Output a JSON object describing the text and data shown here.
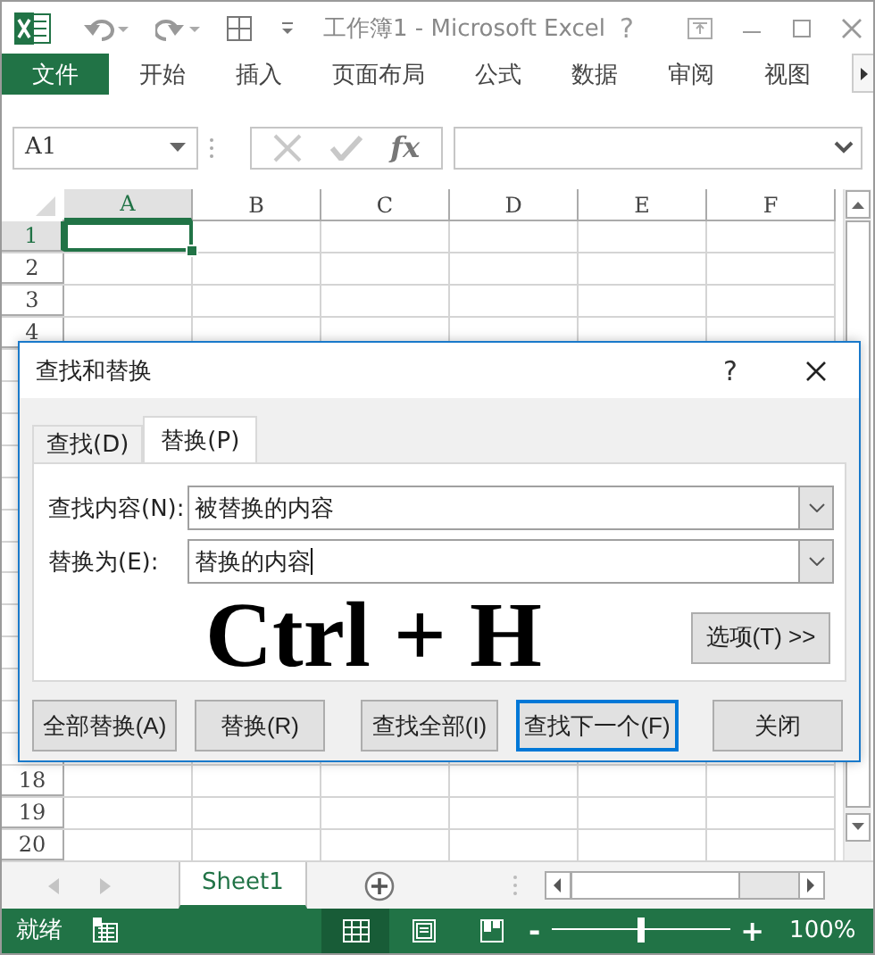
{
  "title_bar": {
    "title": "工作簿1 - Microsoft Excel",
    "help": "?"
  },
  "ribbon_tabs": [
    {
      "label": "文件",
      "kind": "file"
    },
    {
      "label": "开始",
      "kind": "tab"
    },
    {
      "label": "插入",
      "kind": "tab"
    },
    {
      "label": "页面布局",
      "kind": "tab"
    },
    {
      "label": "公式",
      "kind": "tab"
    },
    {
      "label": "数据",
      "kind": "tab"
    },
    {
      "label": "审阅",
      "kind": "tab"
    },
    {
      "label": "视图",
      "kind": "tab"
    }
  ],
  "name_box": {
    "value": "A1"
  },
  "formula_bar": {
    "function_label": "fx"
  },
  "columns": [
    {
      "label": "A",
      "selected": true
    },
    {
      "label": "B",
      "selected": false
    },
    {
      "label": "C",
      "selected": false
    },
    {
      "label": "D",
      "selected": false
    },
    {
      "label": "E",
      "selected": false
    },
    {
      "label": "F",
      "selected": false
    }
  ],
  "rows_top": [
    {
      "label": "1",
      "selected": true
    },
    {
      "label": "2",
      "selected": false
    },
    {
      "label": "3",
      "selected": false
    },
    {
      "label": "4",
      "selected": false
    }
  ],
  "rows_bottom": [
    {
      "label": "18",
      "selected": false
    },
    {
      "label": "19",
      "selected": false
    },
    {
      "label": "20",
      "selected": false
    }
  ],
  "sheet_tabs": [
    {
      "label": "Sheet1",
      "selected": true
    }
  ],
  "status_bar": {
    "status": "就绪",
    "views": [
      {
        "kind": "normal",
        "selected": true
      },
      {
        "kind": "page_layout",
        "selected": false
      },
      {
        "kind": "page_break",
        "selected": false
      }
    ],
    "zoom_out": "-",
    "zoom_in": "+",
    "zoom": {
      "level": 0.5
    },
    "zoom_reading": "100%"
  },
  "dialog": {
    "title": "查找和替换",
    "help": "?",
    "tabs": [
      {
        "label": "查找(D)",
        "selected": false
      },
      {
        "label": "替换(P)",
        "selected": true
      }
    ],
    "fields": [
      {
        "label": "查找内容(N):",
        "value": "被替换的内容",
        "focused": false
      },
      {
        "label": "替换为(E):",
        "value": "替换的内容",
        "focused": true
      }
    ],
    "annotation": "Ctrl + H",
    "options_button": "选项(T) >>",
    "buttons": [
      {
        "label": "全部替换(A)",
        "default": false
      },
      {
        "label": "替换(R)",
        "default": false
      },
      {
        "label": "查找全部(I)",
        "default": false
      },
      {
        "label": "查找下一个(F)",
        "default": true
      },
      {
        "label": "关闭",
        "default": false
      }
    ]
  }
}
